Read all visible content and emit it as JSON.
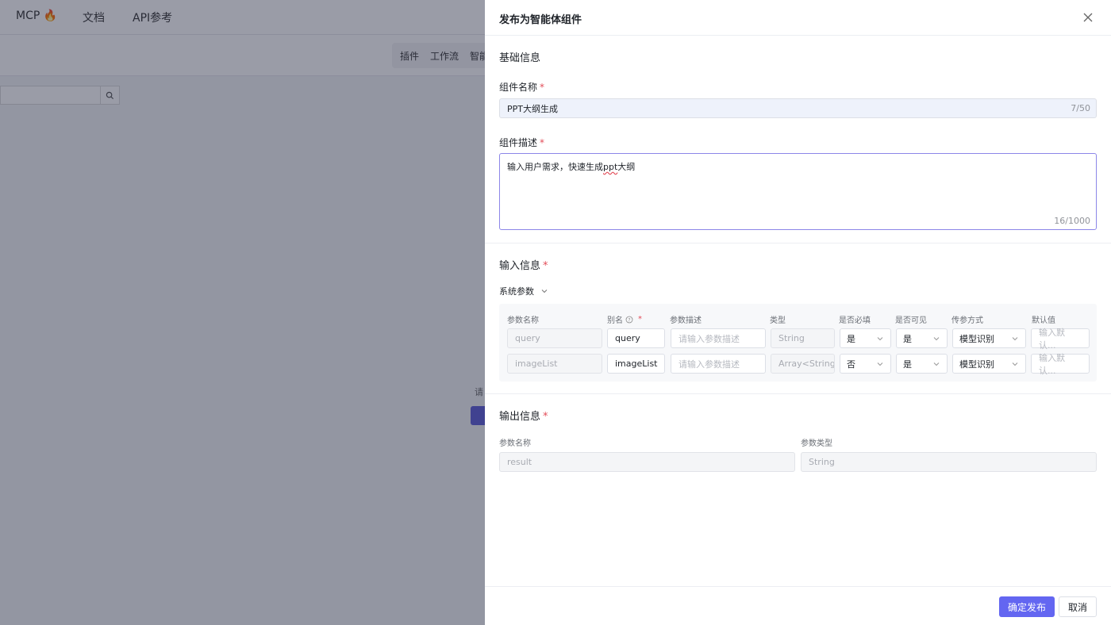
{
  "background": {
    "nav": [
      "MCP",
      "文档",
      "API参考"
    ],
    "subnav": [
      "插件",
      "工作流",
      "智能"
    ],
    "hint": "请"
  },
  "drawer": {
    "title": "发布为智能体组件",
    "basic_info": {
      "section_title": "基础信息",
      "name_label": "组件名称",
      "name_value": "PPT大纲生成",
      "name_counter": "7/50",
      "desc_label": "组件描述",
      "desc_value_prefix": "输入用户需求，快速生成",
      "desc_value_flagged": "ppt",
      "desc_value_suffix": "大纲",
      "desc_counter": "16/1000"
    },
    "input_info": {
      "section_title": "输入信息",
      "system_params_label": "系统参数",
      "columns": {
        "name": "参数名称",
        "alias": "别名",
        "desc": "参数描述",
        "type": "类型",
        "required": "是否必填",
        "visible": "是否可见",
        "pass_mode": "传参方式",
        "default": "默认值"
      },
      "rows": [
        {
          "name": "query",
          "alias": "query",
          "desc_placeholder": "请输入参数描述",
          "type": "String",
          "required": "是",
          "visible": "是",
          "pass_mode": "模型识别",
          "default_placeholder": "输入默认..."
        },
        {
          "name": "imageList",
          "alias": "imageList",
          "desc_placeholder": "请输入参数描述",
          "type": "Array<String",
          "required": "否",
          "visible": "是",
          "pass_mode": "模型识别",
          "default_placeholder": "输入默认..."
        }
      ]
    },
    "output_info": {
      "section_title": "输出信息",
      "name_col": "参数名称",
      "type_col": "参数类型",
      "name_value": "result",
      "type_value": "String"
    },
    "footer": {
      "confirm_label": "确定发布",
      "cancel_label": "取消"
    }
  },
  "colors": {
    "primary": "#6366f1",
    "required": "#e34d59",
    "mask": "#1e233c"
  }
}
